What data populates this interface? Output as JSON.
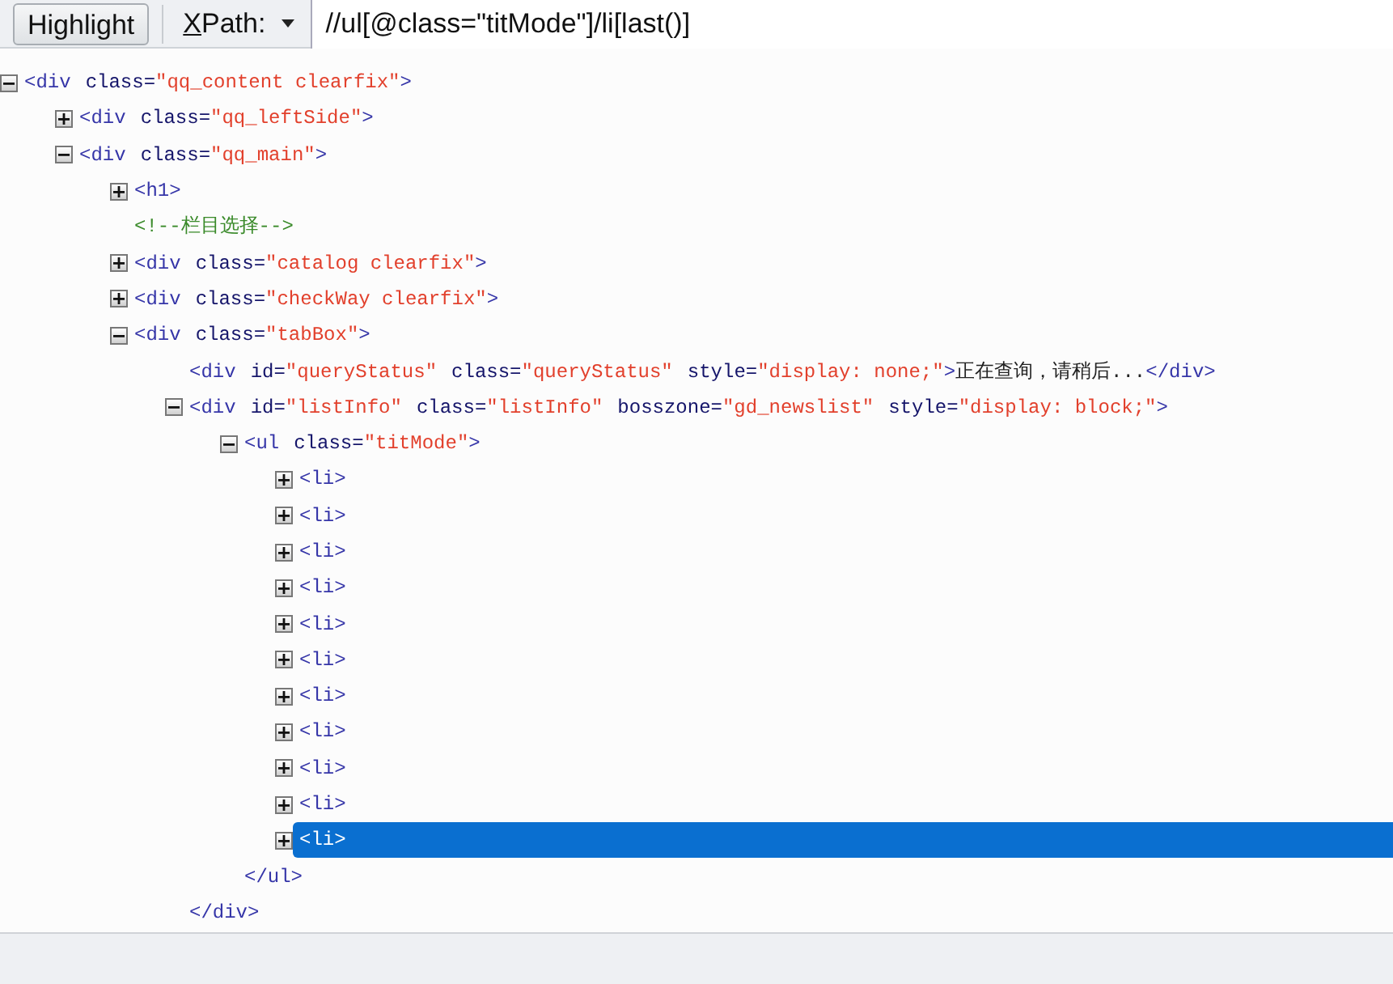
{
  "toolbar": {
    "highlight_button": "Highlight",
    "xpath_mode": "XPath:",
    "query": "//ul[@class=\"titMode\"]/li[last()]"
  },
  "tree": [
    {
      "kind": "element",
      "tag": "<div",
      "attrs": [
        {
          "name": "class=",
          "value": "\"qq_content clearfix\""
        }
      ],
      "end": ">",
      "expanded": true,
      "selected": false,
      "children": [
        {
          "kind": "element",
          "tag": "<div",
          "attrs": [
            {
              "name": "class=",
              "value": "\"qq_leftSide\""
            }
          ],
          "end": ">",
          "expanded": false,
          "selected": false
        },
        {
          "kind": "element",
          "tag": "<div",
          "attrs": [
            {
              "name": "class=",
              "value": "\"qq_main\""
            }
          ],
          "end": ">",
          "expanded": true,
          "selected": false,
          "children": [
            {
              "kind": "element",
              "tag": "<h1>",
              "expanded": false,
              "selected": false
            },
            {
              "kind": "comment",
              "text": "<!--栏目选择-->",
              "selected": false
            },
            {
              "kind": "element",
              "tag": "<div",
              "attrs": [
                {
                  "name": "class=",
                  "value": "\"catalog clearfix\""
                }
              ],
              "end": ">",
              "expanded": false,
              "selected": false
            },
            {
              "kind": "element",
              "tag": "<div",
              "attrs": [
                {
                  "name": "class=",
                  "value": "\"checkWay clearfix\""
                }
              ],
              "end": ">",
              "expanded": false,
              "selected": false
            },
            {
              "kind": "element",
              "tag": "<div",
              "attrs": [
                {
                  "name": "class=",
                  "value": "\"tabBox\""
                }
              ],
              "end": ">",
              "expanded": true,
              "selected": false,
              "children": [
                {
                  "kind": "leaf",
                  "tag": "<div",
                  "attrs": [
                    {
                      "name": "id=",
                      "value": "\"queryStatus\""
                    },
                    {
                      "name": "class=",
                      "value": "\"queryStatus\""
                    },
                    {
                      "name": "style=",
                      "value": "\"display: none;\""
                    }
                  ],
                  "end": ">",
                  "text": "正在查询，请稍后...",
                  "closing": "</div>",
                  "selected": false
                },
                {
                  "kind": "element",
                  "tag": "<div",
                  "attrs": [
                    {
                      "name": "id=",
                      "value": "\"listInfo\""
                    },
                    {
                      "name": "class=",
                      "value": "\"listInfo\""
                    },
                    {
                      "name": "bosszone=",
                      "value": "\"gd_newslist\""
                    },
                    {
                      "name": "style=",
                      "value": "\"display: block;\""
                    }
                  ],
                  "end": ">",
                  "expanded": true,
                  "selected": false,
                  "closing": "</div>",
                  "children": [
                    {
                      "kind": "element",
                      "tag": "<ul",
                      "attrs": [
                        {
                          "name": "class=",
                          "value": "\"titMode\""
                        }
                      ],
                      "end": ">",
                      "expanded": true,
                      "selected": false,
                      "closing": "</ul>",
                      "children": [
                        {
                          "kind": "element",
                          "tag": "<li>",
                          "expanded": false,
                          "selected": false
                        },
                        {
                          "kind": "element",
                          "tag": "<li>",
                          "expanded": false,
                          "selected": false
                        },
                        {
                          "kind": "element",
                          "tag": "<li>",
                          "expanded": false,
                          "selected": false
                        },
                        {
                          "kind": "element",
                          "tag": "<li>",
                          "expanded": false,
                          "selected": false
                        },
                        {
                          "kind": "element",
                          "tag": "<li>",
                          "expanded": false,
                          "selected": false
                        },
                        {
                          "kind": "element",
                          "tag": "<li>",
                          "expanded": false,
                          "selected": false
                        },
                        {
                          "kind": "element",
                          "tag": "<li>",
                          "expanded": false,
                          "selected": false
                        },
                        {
                          "kind": "element",
                          "tag": "<li>",
                          "expanded": false,
                          "selected": false
                        },
                        {
                          "kind": "element",
                          "tag": "<li>",
                          "expanded": false,
                          "selected": false
                        },
                        {
                          "kind": "element",
                          "tag": "<li>",
                          "expanded": false,
                          "selected": false
                        },
                        {
                          "kind": "element",
                          "tag": "<li>",
                          "expanded": false,
                          "selected": true
                        }
                      ]
                    }
                  ]
                }
              ]
            }
          ]
        }
      ]
    }
  ]
}
